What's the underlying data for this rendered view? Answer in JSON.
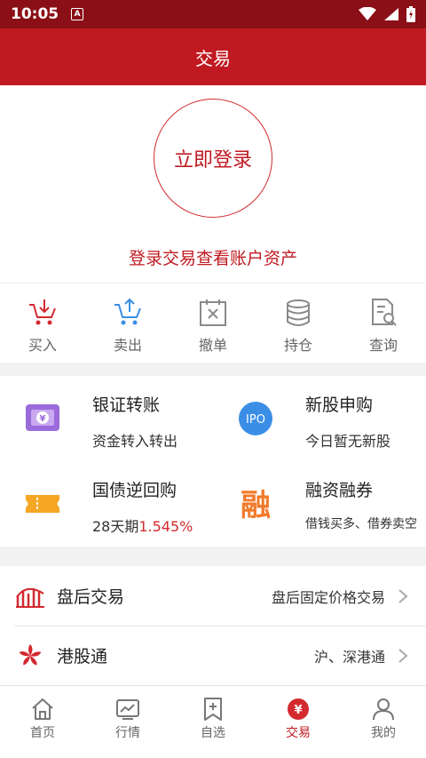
{
  "status_bar": {
    "time": "10:05",
    "badge": "A"
  },
  "app_bar": {
    "title": "交易"
  },
  "login": {
    "button_label": "立即登录",
    "hint": "登录交易查看账户资产"
  },
  "quick_actions": [
    {
      "label": "买入",
      "icon": "cart-down-icon"
    },
    {
      "label": "卖出",
      "icon": "cart-up-icon"
    },
    {
      "label": "撤单",
      "icon": "cancel-order-icon"
    },
    {
      "label": "持仓",
      "icon": "database-icon"
    },
    {
      "label": "查询",
      "icon": "search-document-icon"
    }
  ],
  "features": [
    {
      "title": "银证转账",
      "subtitle": "资金转入转出",
      "icon": "transfer-icon"
    },
    {
      "title": "新股申购",
      "subtitle": "今日暂无新股",
      "icon": "ipo-icon",
      "icon_text": "IPO"
    },
    {
      "title": "国债逆回购",
      "subtitle_prefix": "28天期",
      "subtitle_value": "1.545%",
      "icon": "ticket-icon"
    },
    {
      "title": "融资融券",
      "subtitle": "借钱买多、借券卖空",
      "icon": "margin-icon",
      "icon_text": "融"
    }
  ],
  "list": [
    {
      "title": "盘后交易",
      "subtitle": "盘后固定价格交易",
      "icon": "after-hours-icon"
    },
    {
      "title": "港股通",
      "subtitle": "沪、深港通",
      "icon": "bauhinia-icon"
    }
  ],
  "tabs": [
    {
      "label": "首页",
      "icon": "home-icon"
    },
    {
      "label": "行情",
      "icon": "market-icon"
    },
    {
      "label": "自选",
      "icon": "watchlist-icon"
    },
    {
      "label": "交易",
      "icon": "trade-icon",
      "active": true,
      "glyph": "¥"
    },
    {
      "label": "我的",
      "icon": "profile-icon"
    }
  ],
  "colors": {
    "brand": "#c01921",
    "status_bar": "#8b0f16",
    "accent_blue": "#3a8ee6",
    "accent_orange": "#f27a2a",
    "accent_purple": "#9b6bdc"
  }
}
